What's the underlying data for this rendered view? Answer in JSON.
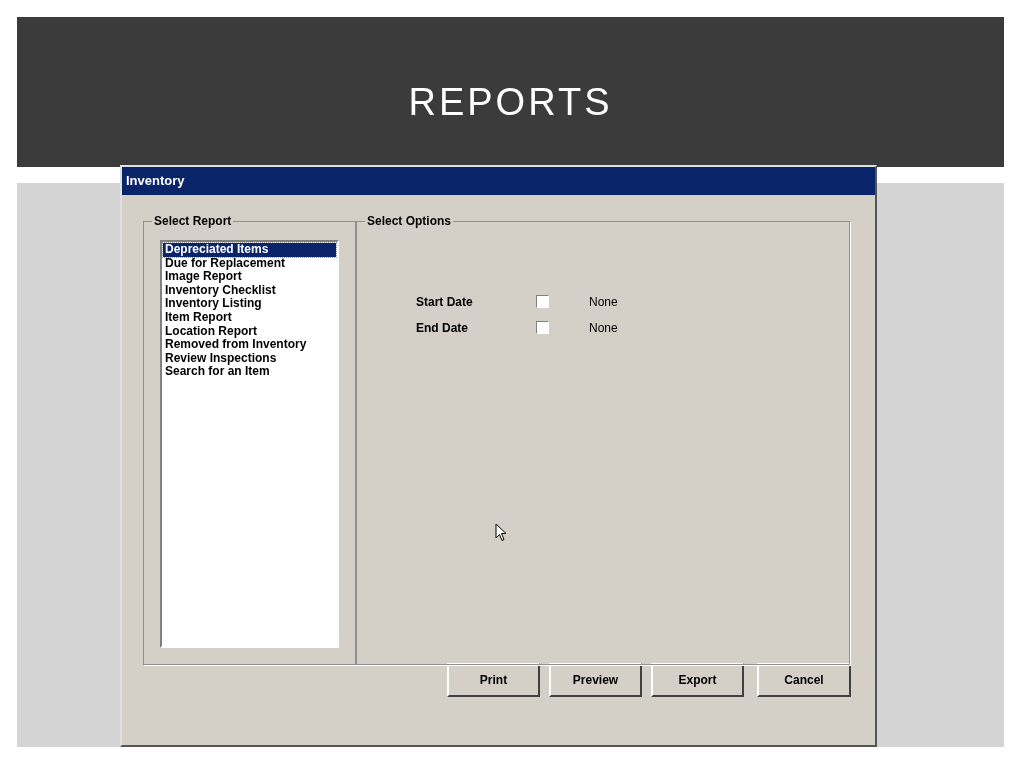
{
  "slide": {
    "title": "REPORTS"
  },
  "window": {
    "title": "Inventory"
  },
  "report_group": {
    "label": "Select Report"
  },
  "reports": [
    {
      "label": "Depreciated Items",
      "selected": true
    },
    {
      "label": "Due for Replacement",
      "selected": false
    },
    {
      "label": "Image Report",
      "selected": false
    },
    {
      "label": "Inventory Checklist",
      "selected": false
    },
    {
      "label": "Inventory Listing",
      "selected": false
    },
    {
      "label": "Item Report",
      "selected": false
    },
    {
      "label": "Location Report",
      "selected": false
    },
    {
      "label": "Removed from Inventory",
      "selected": false
    },
    {
      "label": "Review Inspections",
      "selected": false
    },
    {
      "label": "Search for an Item",
      "selected": false
    }
  ],
  "options_group": {
    "label": "Select Options"
  },
  "options": [
    {
      "label": "Start Date",
      "checked": false,
      "value": "None"
    },
    {
      "label": "End Date",
      "checked": false,
      "value": "None"
    }
  ],
  "buttons": [
    "Print",
    "Preview",
    "Export",
    "Cancel"
  ]
}
